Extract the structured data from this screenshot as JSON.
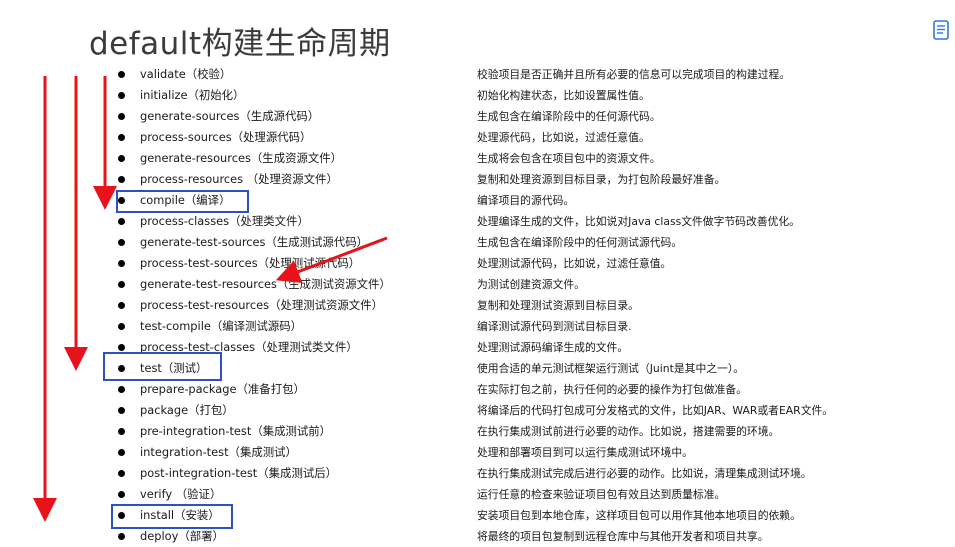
{
  "title": "default构建生命周期",
  "icons": {
    "notes": "notes-icon",
    "bullet": "bullet-dot"
  },
  "colors": {
    "arrow": "#e8121a",
    "highlight": "#2f4fc4",
    "title": "#3b3b3b"
  },
  "phases": [
    {
      "name": "validate（校验）",
      "desc": "校验项目是否正确并且所有必要的信息可以完成项目的构建过程。"
    },
    {
      "name": "initialize（初始化）",
      "desc": "初始化构建状态，比如设置属性值。"
    },
    {
      "name": "generate-sources（生成源代码）",
      "desc": "生成包含在编译阶段中的任何源代码。"
    },
    {
      "name": "process-sources（处理源代码）",
      "desc": "处理源代码，比如说，过滤任意值。"
    },
    {
      "name": "generate-resources（生成资源文件）",
      "desc": "生成将会包含在项目包中的资源文件。"
    },
    {
      "name": "process-resources （处理资源文件）",
      "desc": "复制和处理资源到目标目录，为打包阶段最好准备。"
    },
    {
      "name": "compile（编译）",
      "desc": "编译项目的源代码。"
    },
    {
      "name": "process-classes（处理类文件）",
      "desc": "处理编译生成的文件，比如说对Java class文件做字节码改善优化。"
    },
    {
      "name": "generate-test-sources（生成测试源代码）",
      "desc": "生成包含在编译阶段中的任何测试源代码。"
    },
    {
      "name": "process-test-sources（处理测试源代码）",
      "desc": "处理测试源代码，比如说，过滤任意值。"
    },
    {
      "name": "generate-test-resources（生成测试资源文件）",
      "desc": "为测试创建资源文件。"
    },
    {
      "name": "process-test-resources（处理测试资源文件）",
      "desc": "复制和处理测试资源到目标目录。"
    },
    {
      "name": "test-compile（编译测试源码）",
      "desc": "编译测试源代码到测试目标目录."
    },
    {
      "name": "process-test-classes（处理测试类文件）",
      "desc": "处理测试源码编译生成的文件。"
    },
    {
      "name": "test（测试）",
      "desc": "使用合适的单元测试框架运行测试（Juint是其中之一）。"
    },
    {
      "name": "prepare-package（准备打包）",
      "desc": "在实际打包之前，执行任何的必要的操作为打包做准备。"
    },
    {
      "name": "package（打包）",
      "desc": "将编译后的代码打包成可分发格式的文件，比如JAR、WAR或者EAR文件。"
    },
    {
      "name": "pre-integration-test（集成测试前）",
      "desc": "在执行集成测试前进行必要的动作。比如说，搭建需要的环境。"
    },
    {
      "name": "integration-test（集成测试）",
      "desc": "处理和部署项目到可以运行集成测试环境中。"
    },
    {
      "name": "post-integration-test（集成测试后）",
      "desc": "在执行集成测试完成后进行必要的动作。比如说，清理集成测试环境。"
    },
    {
      "name": "verify （验证）",
      "desc": "运行任意的检查来验证项目包有效且达到质量标准。"
    },
    {
      "name": "install（安装）",
      "desc": "安装项目包到本地仓库，这样项目包可以用作其他本地项目的依赖。"
    },
    {
      "name": "deploy（部署）",
      "desc": "将最终的项目包复制到远程仓库中与其他开发者和项目共享。"
    }
  ]
}
